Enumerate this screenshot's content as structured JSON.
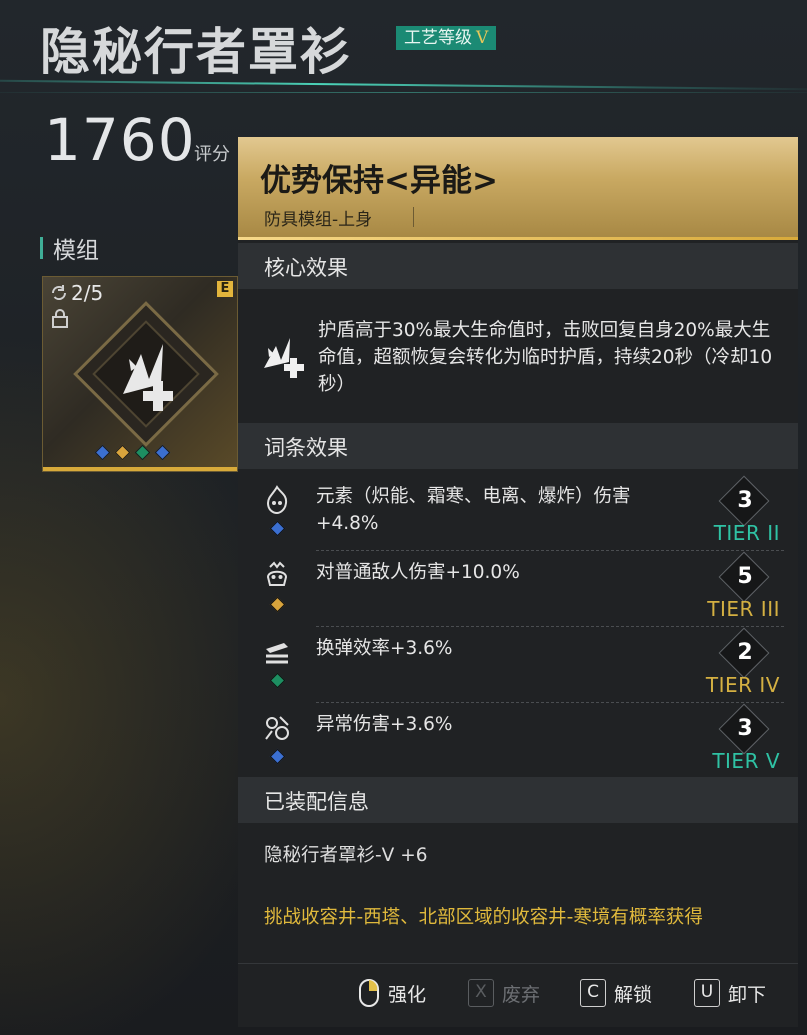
{
  "header": {
    "title": "隐秘行者罩衫",
    "craft_label": "工艺等级",
    "craft_level": "V",
    "score_value": "1760",
    "score_label": "评分"
  },
  "modules": {
    "section_label": "模组",
    "card": {
      "count": "2/5",
      "rarity": "E",
      "slot_colors": [
        "blue",
        "gold",
        "green",
        "blue"
      ]
    }
  },
  "tooltip": {
    "name": "优势保持<异能>",
    "subtitle": "防具模组-上身",
    "core_section": "核心效果",
    "core_text": "护盾高于30%最大生命值时，击败回复自身20%最大生命值，超额恢复会转化为临时护盾，持续20秒（冷却10秒）",
    "affix_section": "词条效果",
    "affixes": [
      {
        "text": "元素（炽能、霜寒、电离、爆炸）伤害+4.8%",
        "level": "3",
        "tier": "TIER II",
        "slot_color": "#3b6fd1",
        "tier_color": "green",
        "icon": "flame-skull-icon"
      },
      {
        "text": "对普通敌人伤害+10.0%",
        "level": "5",
        "tier": "TIER III",
        "slot_color": "#d9a43c",
        "tier_color": "gold",
        "icon": "skull-icon"
      },
      {
        "text": "换弹效率+3.6%",
        "level": "2",
        "tier": "TIER IV",
        "slot_color": "#1d8e61",
        "tier_color": "gold",
        "icon": "reload-icon"
      },
      {
        "text": "异常伤害+3.6%",
        "level": "3",
        "tier": "TIER V",
        "slot_color": "#3b6fd1",
        "tier_color": "green",
        "icon": "anomaly-icon"
      }
    ],
    "equipped_section": "已装配信息",
    "equipped_text": "隐秘行者罩衫-V +6",
    "source_text": "挑战收容井-西塔、北部区域的收容井-寒境有概率获得"
  },
  "actions": {
    "enhance": {
      "label": "强化"
    },
    "discard": {
      "key": "X",
      "label": "废弃"
    },
    "unlock": {
      "key": "C",
      "label": "解锁"
    },
    "unequip": {
      "key": "U",
      "label": "卸下"
    }
  },
  "colors": {
    "accent_teal": "#1b8a74",
    "gold": "#e0b93c",
    "tier_green": "#2fc2a4"
  }
}
